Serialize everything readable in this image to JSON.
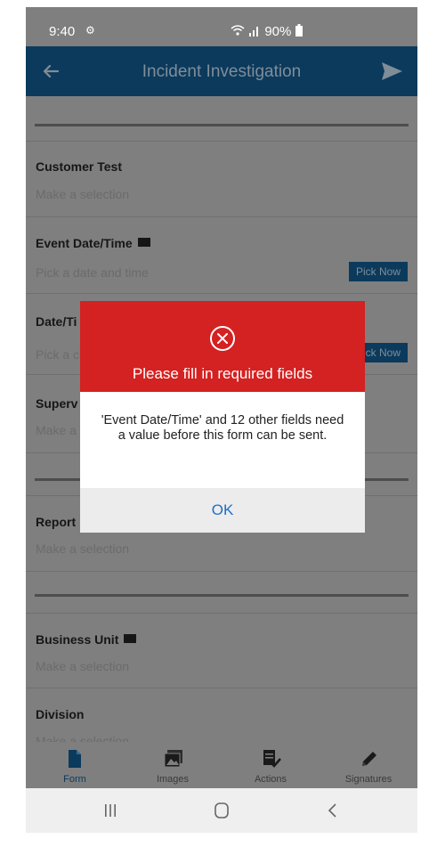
{
  "status_bar": {
    "time": "9:40",
    "battery": "90%"
  },
  "app_bar": {
    "title": "Incident Investigation"
  },
  "form": {
    "fields": [
      {
        "label": "Customer Test",
        "hint": "Make a selection",
        "required": false
      },
      {
        "label": "Event Date/Time",
        "hint": "Pick a date and time",
        "required": true,
        "button": "Pick Now"
      },
      {
        "label": "Date/Ti",
        "hint": "Pick a c",
        "required": false,
        "button": "ck Now"
      },
      {
        "label": "Superv",
        "hint": "Make a",
        "required": false
      },
      {
        "label": "Report",
        "hint": "Make a selection",
        "required": false
      },
      {
        "label": "Business Unit",
        "hint": "Make a selection",
        "required": true
      },
      {
        "label": "Division",
        "hint": "Make a selection",
        "required": false
      }
    ]
  },
  "dialog": {
    "title": "Please fill in required fields",
    "message": "'Event Date/Time' and 12 other fields need a value before this form can be sent.",
    "ok_label": "OK",
    "header_color": "#d42121",
    "ok_color": "#1f6ec4"
  },
  "bottom_nav": {
    "items": [
      {
        "label": "Form",
        "icon": "document-icon",
        "active": true
      },
      {
        "label": "Images",
        "icon": "images-icon",
        "active": false
      },
      {
        "label": "Actions",
        "icon": "actions-icon",
        "active": false
      },
      {
        "label": "Signatures",
        "icon": "pencil-icon",
        "active": false
      }
    ]
  }
}
